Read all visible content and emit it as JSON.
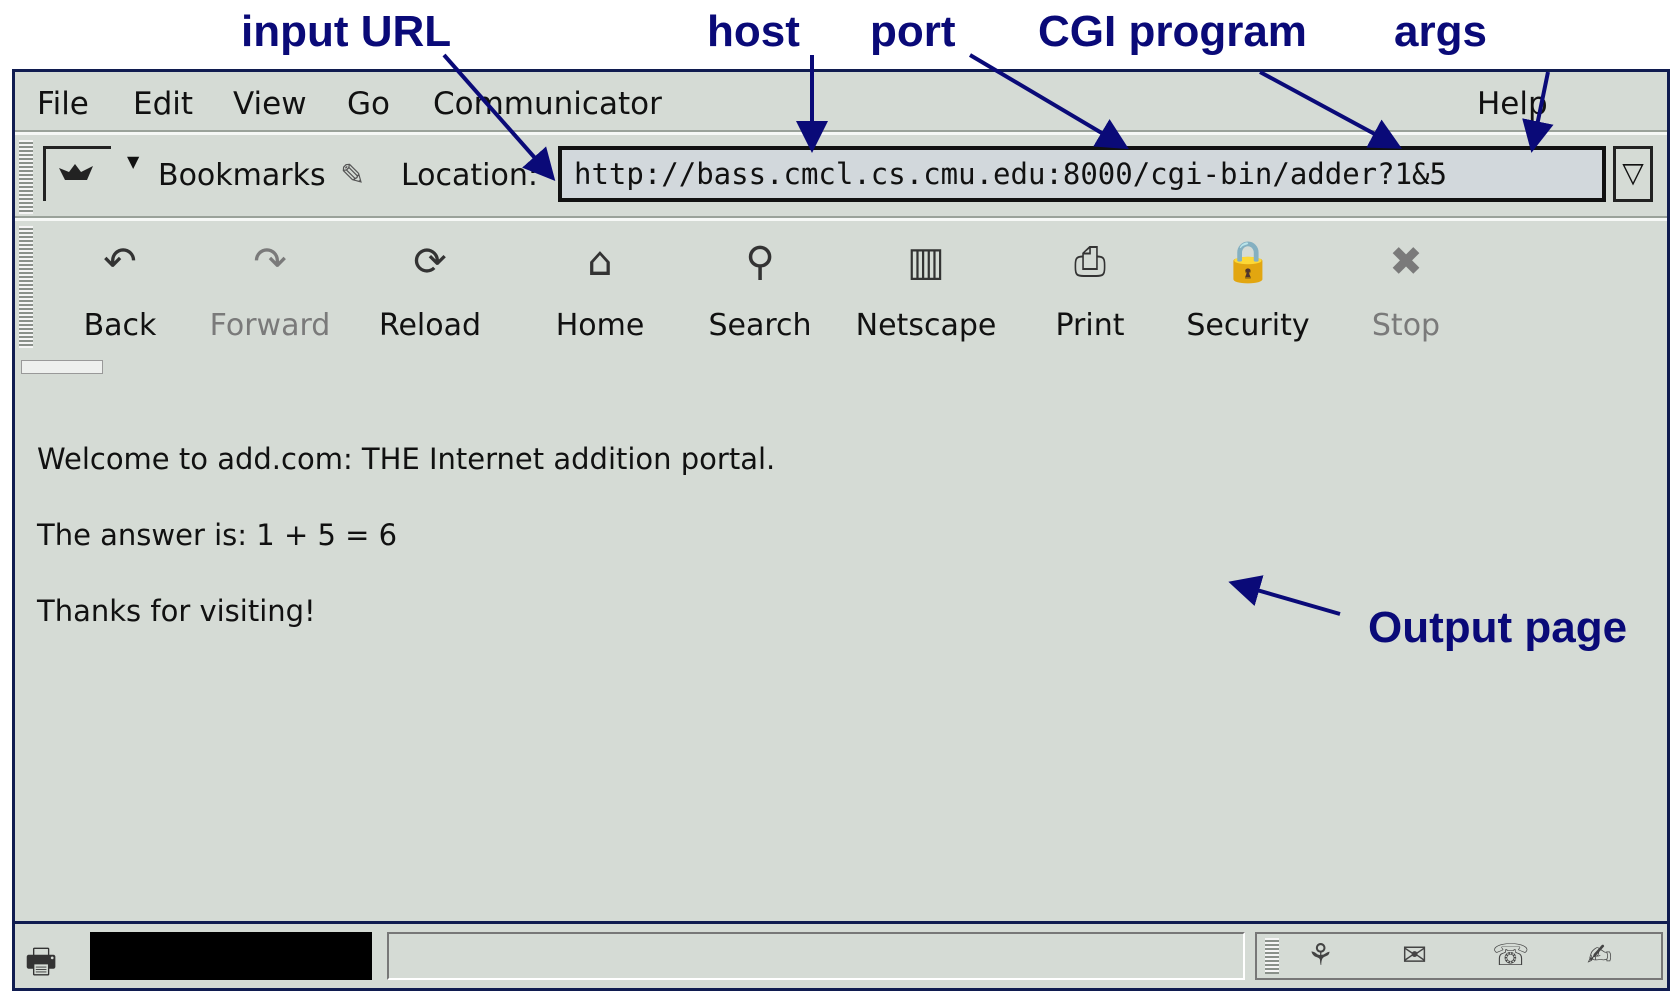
{
  "annotations": {
    "input_url": "input URL",
    "host": "host",
    "port": "port",
    "cgi_program": "CGI program",
    "args": "args",
    "output_page": "Output page"
  },
  "menu": [
    "File",
    "Edit",
    "View",
    "Go",
    "Communicator",
    "Help"
  ],
  "locationbar": {
    "bookmarks_label": "Bookmarks",
    "location_label": "Location:",
    "url": "http://bass.cmcl.cs.cmu.edu:8000/cgi-bin/adder?1&5"
  },
  "toolbar": {
    "back": "Back",
    "forward": "Forward",
    "reload": "Reload",
    "home": "Home",
    "search": "Search",
    "netscape": "Netscape",
    "print": "Print",
    "security": "Security",
    "stop": "Stop"
  },
  "content": {
    "line1": "Welcome to add.com: THE Internet addition portal.",
    "line2": "The answer is: 1 + 5 = 6",
    "line3": "Thanks for visiting!"
  },
  "colors": {
    "annotation": "#0a0a78",
    "window_bg": "#d5dbd5",
    "url_bg": "#d2d8dc"
  }
}
